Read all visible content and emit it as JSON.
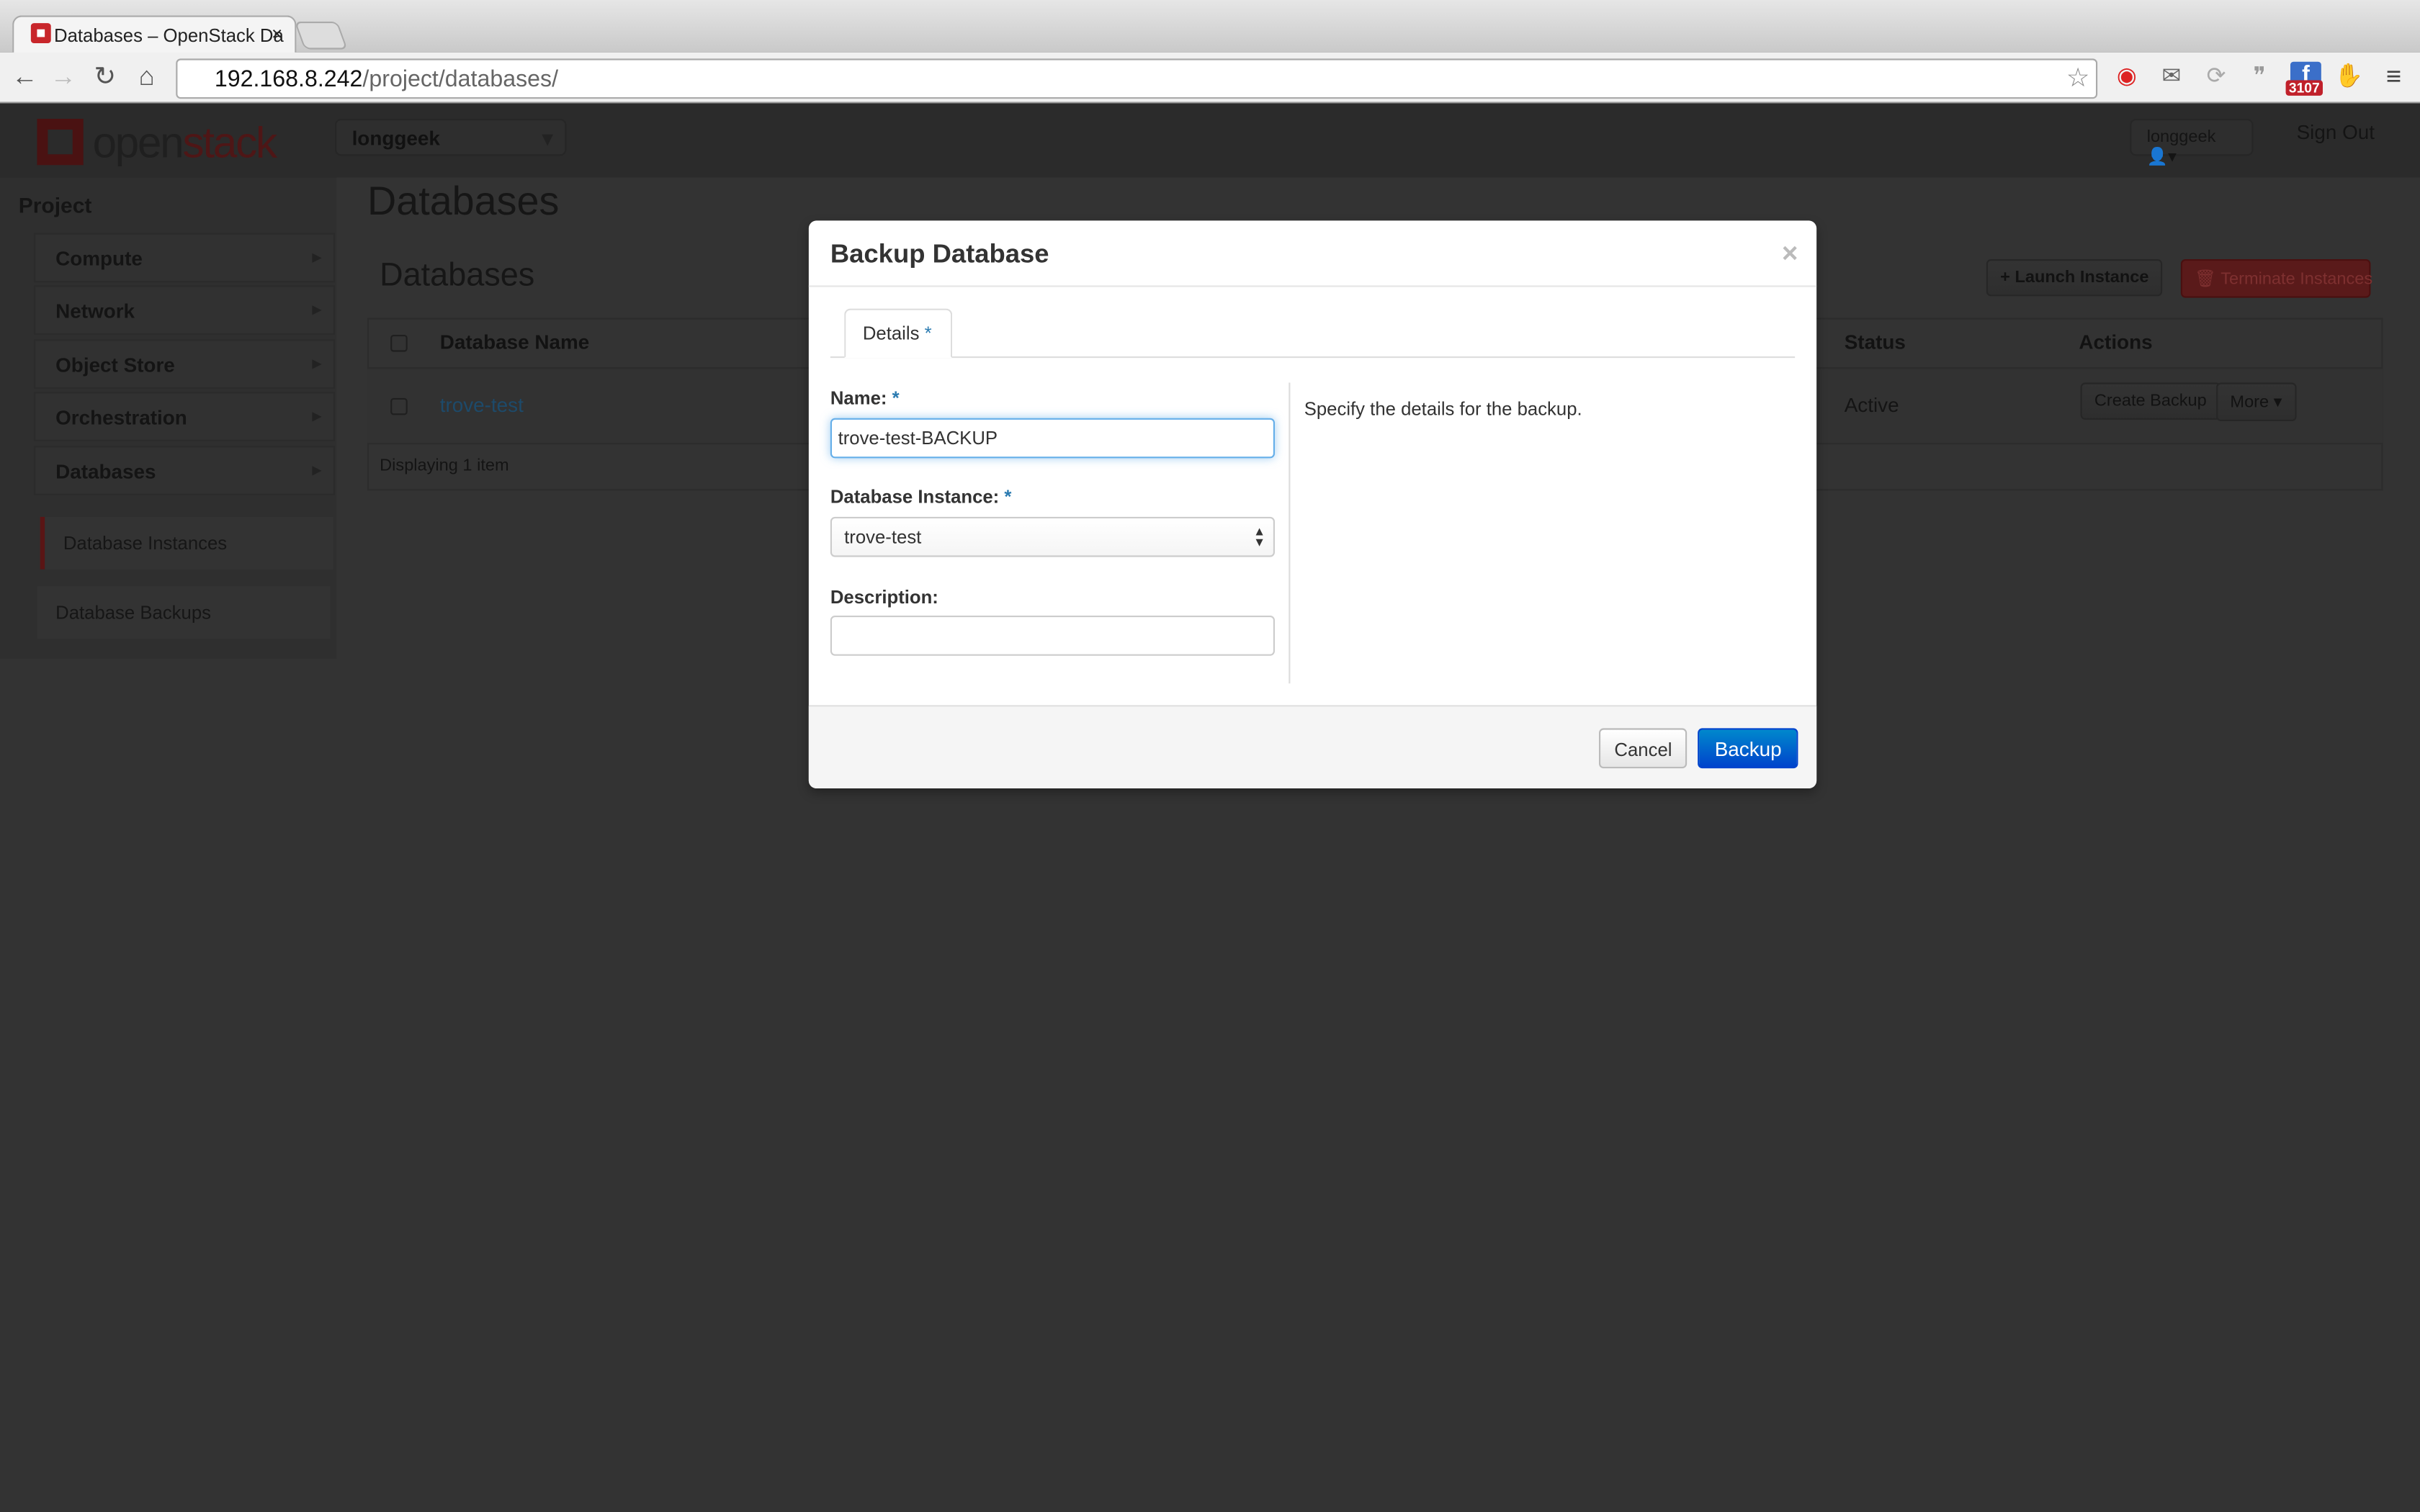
{
  "browser": {
    "tab_title": "Databases – OpenStack Da",
    "url_host": "192.168.8.242",
    "url_path": "/project/databases/",
    "extension_badge": "3107"
  },
  "header": {
    "logo_a": "open",
    "logo_b": "stack",
    "project": "longgeek",
    "user": "longgeek",
    "sign_out": "Sign Out"
  },
  "sidebar": {
    "heading": "Project",
    "items": [
      {
        "label": "Compute"
      },
      {
        "label": "Network"
      },
      {
        "label": "Object Store"
      },
      {
        "label": "Orchestration"
      },
      {
        "label": "Databases"
      }
    ],
    "sub_items": [
      {
        "label": "Database Instances",
        "active": true
      },
      {
        "label": "Database Backups"
      }
    ]
  },
  "main": {
    "page_title": "Databases",
    "section_title": "Databases",
    "launch": "Launch Instance",
    "terminate": "Terminate Instances",
    "columns": [
      "Database Name",
      "Status",
      "Actions"
    ],
    "rows": [
      {
        "name": "trove-test",
        "status": "Active",
        "action": "Create Backup",
        "more": "More"
      }
    ],
    "footer": "Displaying 1 item"
  },
  "modal": {
    "title": "Backup Database",
    "close": "×",
    "tab": "Details",
    "required": "*",
    "name_label": "Name:",
    "name_value": "trove-test-BACKUP",
    "instance_label": "Database Instance:",
    "instance_value": "trove-test",
    "description_label": "Description:",
    "description_value": "",
    "help": "Specify the details for the backup.",
    "cancel": "Cancel",
    "submit": "Backup"
  },
  "colors": {
    "primary": "#0055cc",
    "danger": "#c8262b",
    "link": "#2a7ab0"
  }
}
